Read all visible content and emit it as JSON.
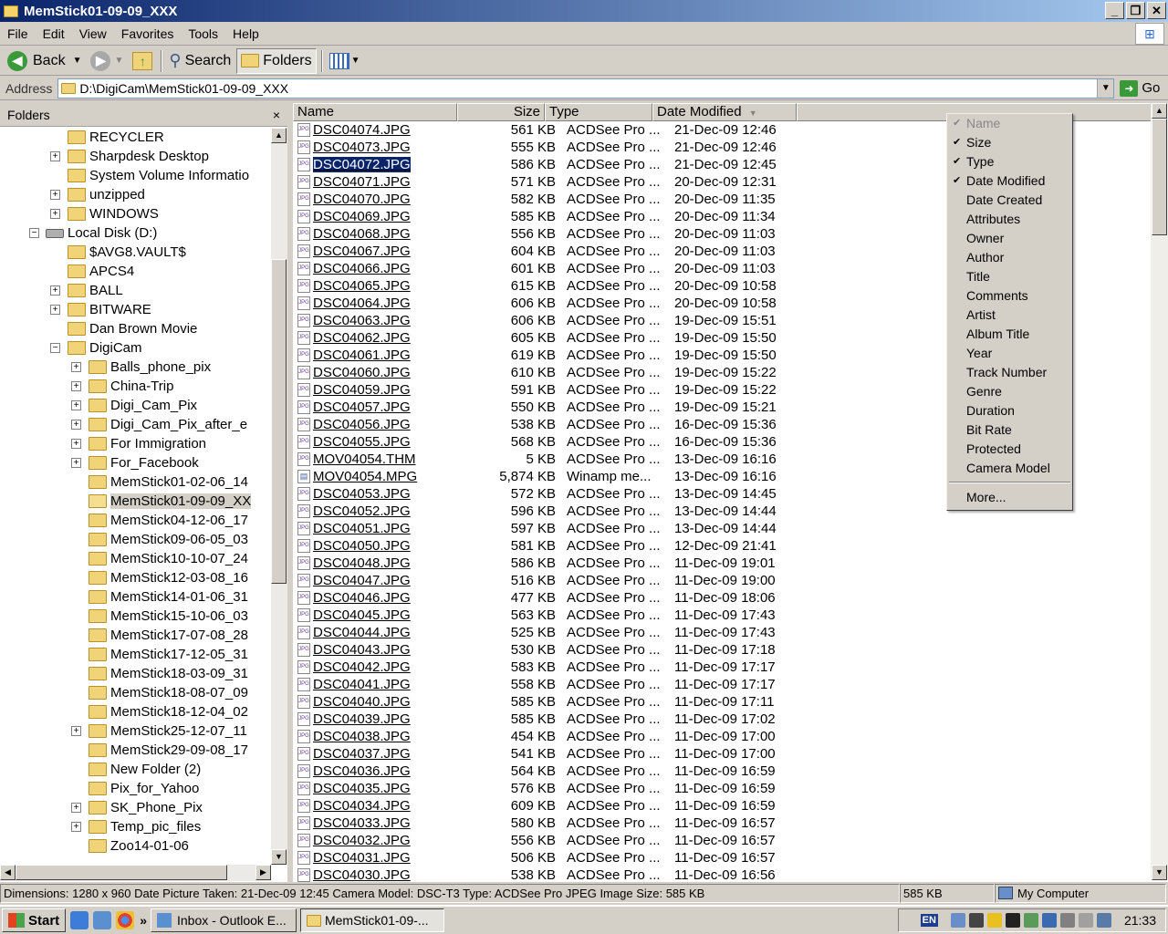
{
  "window": {
    "title": "MemStick01-09-09_XXX",
    "controls": [
      "_",
      "❐",
      "✕"
    ]
  },
  "menu": [
    "File",
    "Edit",
    "View",
    "Favorites",
    "Tools",
    "Help"
  ],
  "toolbar": {
    "back": "Back",
    "search": "Search",
    "folders": "Folders"
  },
  "address": {
    "label": "Address",
    "value": "D:\\DigiCam\\MemStick01-09-09_XXX",
    "go": "Go"
  },
  "folders_pane": {
    "title": "Folders",
    "close": "×",
    "tree": [
      {
        "label": "RECYCLER",
        "level": 2,
        "expander": ""
      },
      {
        "label": "Sharpdesk Desktop",
        "level": 2,
        "expander": "+"
      },
      {
        "label": "System Volume Informatio",
        "level": 2,
        "expander": ""
      },
      {
        "label": "unzipped",
        "level": 2,
        "expander": "+"
      },
      {
        "label": "WINDOWS",
        "level": 2,
        "expander": "+"
      },
      {
        "label": "Local Disk (D:)",
        "level": 1,
        "expander": "−",
        "icon": "drive"
      },
      {
        "label": "$AVG8.VAULT$",
        "level": 2,
        "expander": ""
      },
      {
        "label": "APCS4",
        "level": 2,
        "expander": ""
      },
      {
        "label": "BALL",
        "level": 2,
        "expander": "+"
      },
      {
        "label": "BITWARE",
        "level": 2,
        "expander": "+"
      },
      {
        "label": "Dan Brown Movie",
        "level": 2,
        "expander": ""
      },
      {
        "label": "DigiCam",
        "level": 2,
        "expander": "−"
      },
      {
        "label": "Balls_phone_pix",
        "level": 3,
        "expander": "+"
      },
      {
        "label": "China-Trip",
        "level": 3,
        "expander": "+"
      },
      {
        "label": "Digi_Cam_Pix",
        "level": 3,
        "expander": "+"
      },
      {
        "label": "Digi_Cam_Pix_after_e",
        "level": 3,
        "expander": "+"
      },
      {
        "label": "For Immigration",
        "level": 3,
        "expander": "+"
      },
      {
        "label": "For_Facebook",
        "level": 3,
        "expander": "+"
      },
      {
        "label": "MemStick01-02-06_14",
        "level": 3,
        "expander": ""
      },
      {
        "label": "MemStick01-09-09_XX",
        "level": 3,
        "expander": "",
        "selected": true
      },
      {
        "label": "MemStick04-12-06_17",
        "level": 3,
        "expander": ""
      },
      {
        "label": "MemStick09-06-05_03",
        "level": 3,
        "expander": ""
      },
      {
        "label": "MemStick10-10-07_24",
        "level": 3,
        "expander": ""
      },
      {
        "label": "MemStick12-03-08_16",
        "level": 3,
        "expander": ""
      },
      {
        "label": "MemStick14-01-06_31",
        "level": 3,
        "expander": ""
      },
      {
        "label": "MemStick15-10-06_03",
        "level": 3,
        "expander": ""
      },
      {
        "label": "MemStick17-07-08_28",
        "level": 3,
        "expander": ""
      },
      {
        "label": "MemStick17-12-05_31",
        "level": 3,
        "expander": ""
      },
      {
        "label": "MemStick18-03-09_31",
        "level": 3,
        "expander": ""
      },
      {
        "label": "MemStick18-08-07_09",
        "level": 3,
        "expander": ""
      },
      {
        "label": "MemStick18-12-04_02",
        "level": 3,
        "expander": ""
      },
      {
        "label": "MemStick25-12-07_11",
        "level": 3,
        "expander": "+"
      },
      {
        "label": "MemStick29-09-08_17",
        "level": 3,
        "expander": ""
      },
      {
        "label": "New Folder (2)",
        "level": 3,
        "expander": ""
      },
      {
        "label": "Pix_for_Yahoo",
        "level": 3,
        "expander": ""
      },
      {
        "label": "SK_Phone_Pix",
        "level": 3,
        "expander": "+"
      },
      {
        "label": "Temp_pic_files",
        "level": 3,
        "expander": "+"
      },
      {
        "label": "Zoo14-01-06",
        "level": 3,
        "expander": ""
      }
    ]
  },
  "columns": {
    "name": "Name",
    "size": "Size",
    "type": "Type",
    "date": "Date Modified"
  },
  "files": [
    {
      "name": "DSC04074.JPG",
      "size": "561 KB",
      "type": "ACDSee Pro ...",
      "date": "21-Dec-09 12:46",
      "icon": "jpg"
    },
    {
      "name": "DSC04073.JPG",
      "size": "555 KB",
      "type": "ACDSee Pro ...",
      "date": "21-Dec-09 12:46",
      "icon": "jpg"
    },
    {
      "name": "DSC04072.JPG",
      "size": "586 KB",
      "type": "ACDSee Pro ...",
      "date": "21-Dec-09 12:45",
      "icon": "jpg",
      "selected": true
    },
    {
      "name": "DSC04071.JPG",
      "size": "571 KB",
      "type": "ACDSee Pro ...",
      "date": "20-Dec-09 12:31",
      "icon": "jpg"
    },
    {
      "name": "DSC04070.JPG",
      "size": "582 KB",
      "type": "ACDSee Pro ...",
      "date": "20-Dec-09 11:35",
      "icon": "jpg"
    },
    {
      "name": "DSC04069.JPG",
      "size": "585 KB",
      "type": "ACDSee Pro ...",
      "date": "20-Dec-09 11:34",
      "icon": "jpg"
    },
    {
      "name": "DSC04068.JPG",
      "size": "556 KB",
      "type": "ACDSee Pro ...",
      "date": "20-Dec-09 11:03",
      "icon": "jpg"
    },
    {
      "name": "DSC04067.JPG",
      "size": "604 KB",
      "type": "ACDSee Pro ...",
      "date": "20-Dec-09 11:03",
      "icon": "jpg"
    },
    {
      "name": "DSC04066.JPG",
      "size": "601 KB",
      "type": "ACDSee Pro ...",
      "date": "20-Dec-09 11:03",
      "icon": "jpg"
    },
    {
      "name": "DSC04065.JPG",
      "size": "615 KB",
      "type": "ACDSee Pro ...",
      "date": "20-Dec-09 10:58",
      "icon": "jpg"
    },
    {
      "name": "DSC04064.JPG",
      "size": "606 KB",
      "type": "ACDSee Pro ...",
      "date": "20-Dec-09 10:58",
      "icon": "jpg"
    },
    {
      "name": "DSC04063.JPG",
      "size": "606 KB",
      "type": "ACDSee Pro ...",
      "date": "19-Dec-09 15:51",
      "icon": "jpg"
    },
    {
      "name": "DSC04062.JPG",
      "size": "605 KB",
      "type": "ACDSee Pro ...",
      "date": "19-Dec-09 15:50",
      "icon": "jpg"
    },
    {
      "name": "DSC04061.JPG",
      "size": "619 KB",
      "type": "ACDSee Pro ...",
      "date": "19-Dec-09 15:50",
      "icon": "jpg"
    },
    {
      "name": "DSC04060.JPG",
      "size": "610 KB",
      "type": "ACDSee Pro ...",
      "date": "19-Dec-09 15:22",
      "icon": "jpg"
    },
    {
      "name": "DSC04059.JPG",
      "size": "591 KB",
      "type": "ACDSee Pro ...",
      "date": "19-Dec-09 15:22",
      "icon": "jpg"
    },
    {
      "name": "DSC04057.JPG",
      "size": "550 KB",
      "type": "ACDSee Pro ...",
      "date": "19-Dec-09 15:21",
      "icon": "jpg"
    },
    {
      "name": "DSC04056.JPG",
      "size": "538 KB",
      "type": "ACDSee Pro ...",
      "date": "16-Dec-09 15:36",
      "icon": "jpg"
    },
    {
      "name": "DSC04055.JPG",
      "size": "568 KB",
      "type": "ACDSee Pro ...",
      "date": "16-Dec-09 15:36",
      "icon": "jpg"
    },
    {
      "name": "MOV04054.THM",
      "size": "5 KB",
      "type": "ACDSee Pro ...",
      "date": "13-Dec-09 16:16",
      "icon": "jpg"
    },
    {
      "name": "MOV04054.MPG",
      "size": "5,874 KB",
      "type": "Winamp me...",
      "date": "13-Dec-09 16:16",
      "icon": "mpg"
    },
    {
      "name": "DSC04053.JPG",
      "size": "572 KB",
      "type": "ACDSee Pro ...",
      "date": "13-Dec-09 14:45",
      "icon": "jpg"
    },
    {
      "name": "DSC04052.JPG",
      "size": "596 KB",
      "type": "ACDSee Pro ...",
      "date": "13-Dec-09 14:44",
      "icon": "jpg"
    },
    {
      "name": "DSC04051.JPG",
      "size": "597 KB",
      "type": "ACDSee Pro ...",
      "date": "13-Dec-09 14:44",
      "icon": "jpg"
    },
    {
      "name": "DSC04050.JPG",
      "size": "581 KB",
      "type": "ACDSee Pro ...",
      "date": "12-Dec-09 21:41",
      "icon": "jpg"
    },
    {
      "name": "DSC04048.JPG",
      "size": "586 KB",
      "type": "ACDSee Pro ...",
      "date": "11-Dec-09 19:01",
      "icon": "jpg"
    },
    {
      "name": "DSC04047.JPG",
      "size": "516 KB",
      "type": "ACDSee Pro ...",
      "date": "11-Dec-09 19:00",
      "icon": "jpg"
    },
    {
      "name": "DSC04046.JPG",
      "size": "477 KB",
      "type": "ACDSee Pro ...",
      "date": "11-Dec-09 18:06",
      "icon": "jpg"
    },
    {
      "name": "DSC04045.JPG",
      "size": "563 KB",
      "type": "ACDSee Pro ...",
      "date": "11-Dec-09 17:43",
      "icon": "jpg"
    },
    {
      "name": "DSC04044.JPG",
      "size": "525 KB",
      "type": "ACDSee Pro ...",
      "date": "11-Dec-09 17:43",
      "icon": "jpg"
    },
    {
      "name": "DSC04043.JPG",
      "size": "530 KB",
      "type": "ACDSee Pro ...",
      "date": "11-Dec-09 17:18",
      "icon": "jpg"
    },
    {
      "name": "DSC04042.JPG",
      "size": "583 KB",
      "type": "ACDSee Pro ...",
      "date": "11-Dec-09 17:17",
      "icon": "jpg"
    },
    {
      "name": "DSC04041.JPG",
      "size": "558 KB",
      "type": "ACDSee Pro ...",
      "date": "11-Dec-09 17:17",
      "icon": "jpg"
    },
    {
      "name": "DSC04040.JPG",
      "size": "585 KB",
      "type": "ACDSee Pro ...",
      "date": "11-Dec-09 17:11",
      "icon": "jpg"
    },
    {
      "name": "DSC04039.JPG",
      "size": "585 KB",
      "type": "ACDSee Pro ...",
      "date": "11-Dec-09 17:02",
      "icon": "jpg"
    },
    {
      "name": "DSC04038.JPG",
      "size": "454 KB",
      "type": "ACDSee Pro ...",
      "date": "11-Dec-09 17:00",
      "icon": "jpg"
    },
    {
      "name": "DSC04037.JPG",
      "size": "541 KB",
      "type": "ACDSee Pro ...",
      "date": "11-Dec-09 17:00",
      "icon": "jpg"
    },
    {
      "name": "DSC04036.JPG",
      "size": "564 KB",
      "type": "ACDSee Pro ...",
      "date": "11-Dec-09 16:59",
      "icon": "jpg"
    },
    {
      "name": "DSC04035.JPG",
      "size": "576 KB",
      "type": "ACDSee Pro ...",
      "date": "11-Dec-09 16:59",
      "icon": "jpg"
    },
    {
      "name": "DSC04034.JPG",
      "size": "609 KB",
      "type": "ACDSee Pro ...",
      "date": "11-Dec-09 16:59",
      "icon": "jpg"
    },
    {
      "name": "DSC04033.JPG",
      "size": "580 KB",
      "type": "ACDSee Pro ...",
      "date": "11-Dec-09 16:57",
      "icon": "jpg"
    },
    {
      "name": "DSC04032.JPG",
      "size": "556 KB",
      "type": "ACDSee Pro ...",
      "date": "11-Dec-09 16:57",
      "icon": "jpg"
    },
    {
      "name": "DSC04031.JPG",
      "size": "506 KB",
      "type": "ACDSee Pro ...",
      "date": "11-Dec-09 16:57",
      "icon": "jpg"
    },
    {
      "name": "DSC04030.JPG",
      "size": "538 KB",
      "type": "ACDSee Pro ...",
      "date": "11-Dec-09 16:56",
      "icon": "jpg"
    }
  ],
  "column_menu": [
    {
      "label": "Name",
      "checked": true,
      "disabled": true
    },
    {
      "label": "Size",
      "checked": true
    },
    {
      "label": "Type",
      "checked": true
    },
    {
      "label": "Date Modified",
      "checked": true
    },
    {
      "label": "Date Created"
    },
    {
      "label": "Attributes"
    },
    {
      "label": "Owner"
    },
    {
      "label": "Author"
    },
    {
      "label": "Title"
    },
    {
      "label": "Comments"
    },
    {
      "label": "Artist"
    },
    {
      "label": "Album Title"
    },
    {
      "label": "Year"
    },
    {
      "label": "Track Number"
    },
    {
      "label": "Genre"
    },
    {
      "label": "Duration"
    },
    {
      "label": "Bit Rate"
    },
    {
      "label": "Protected"
    },
    {
      "label": "Camera Model"
    },
    {
      "separator": true
    },
    {
      "label": "More..."
    }
  ],
  "status": {
    "details": "Dimensions: 1280 x 960 Date Picture Taken: 21-Dec-09 12:45 Camera Model: DSC-T3 Type: ACDSee Pro JPEG Image Size: 585 KB",
    "size": "585 KB",
    "zone": "My Computer"
  },
  "taskbar": {
    "start": "Start",
    "overflow": "»",
    "tasks": [
      {
        "label": "Inbox - Outlook E...",
        "active": false
      },
      {
        "label": "MemStick01-09-...",
        "active": true
      }
    ],
    "lang": "EN",
    "clock": "21:33"
  },
  "colors": {
    "title_start": "#0a246a",
    "title_end": "#a6caf0",
    "selection": "#0a246a",
    "folder": "#f2d478"
  }
}
